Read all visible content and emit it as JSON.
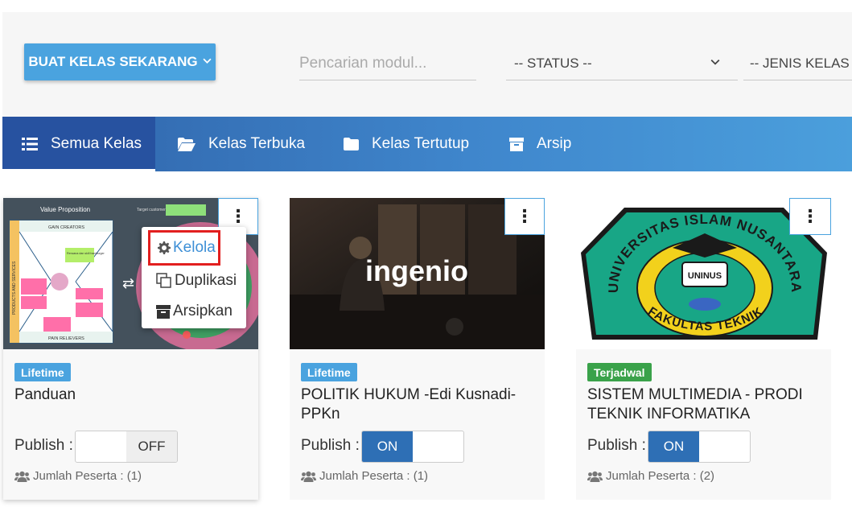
{
  "toolbar": {
    "create_label": "BUAT KELAS SEKARANG",
    "search_placeholder": "Pencarian modul...",
    "status_select": "-- STATUS --",
    "jenis_select": "-- JENIS KELAS --"
  },
  "tabs": [
    {
      "label": "Semua Kelas",
      "icon": "list-icon",
      "active": true
    },
    {
      "label": "Kelas Terbuka",
      "icon": "folder-open-icon",
      "active": false
    },
    {
      "label": "Kelas Tertutup",
      "icon": "folder-icon",
      "active": false
    },
    {
      "label": "Arsip",
      "icon": "archive-icon",
      "active": false
    }
  ],
  "cards": [
    {
      "badge": "Lifetime",
      "badge_color": "#4aa3df",
      "title": "Panduan",
      "publish_label": "Publish :",
      "toggle_state": "OFF",
      "members": "Jumlah Peserta : (1)",
      "thumb": {
        "heading": "Value Proposition",
        "gain": "GAIN CREATORS",
        "pain": "PAIN RELIEVERS",
        "side": "PRODUCTS AND SERVICES",
        "note": "Rencana dan skill hamburger",
        "target": "Target customer"
      }
    },
    {
      "badge": "Lifetime",
      "badge_color": "#4aa3df",
      "title": "POLITIK HUKUM -Edi Kusnadi-PPKn",
      "publish_label": "Publish :",
      "toggle_state": "ON",
      "members": "Jumlah Peserta : (1)",
      "thumb": {
        "logo": "ingenio"
      }
    },
    {
      "badge": "Terjadwal",
      "badge_color": "#3aa24a",
      "title": "SISTEM MULTIMEDIA - PRODI TEKNIK INFORMATIKA",
      "publish_label": "Publish :",
      "toggle_state": "ON",
      "members": "Jumlah Peserta : (2)",
      "thumb": {
        "arc_top": "UNIVERSITAS ISLAM NUSANTARA",
        "arc_bottom": "FAKULTAS TEKNIK",
        "center": "UNINUS"
      }
    }
  ],
  "card_menu": {
    "kelola": "Kelola",
    "duplikasi": "Duplikasi",
    "arsipkan": "Arsipkan"
  },
  "toggle_text": {
    "on": "ON",
    "off": "OFF"
  },
  "kebab_glyph": "⋮",
  "colors": {
    "accent": "#4aa3df",
    "tab_active": "#2752a0",
    "toggle_on": "#2e6fb5",
    "highlight": "#e21f1f"
  }
}
